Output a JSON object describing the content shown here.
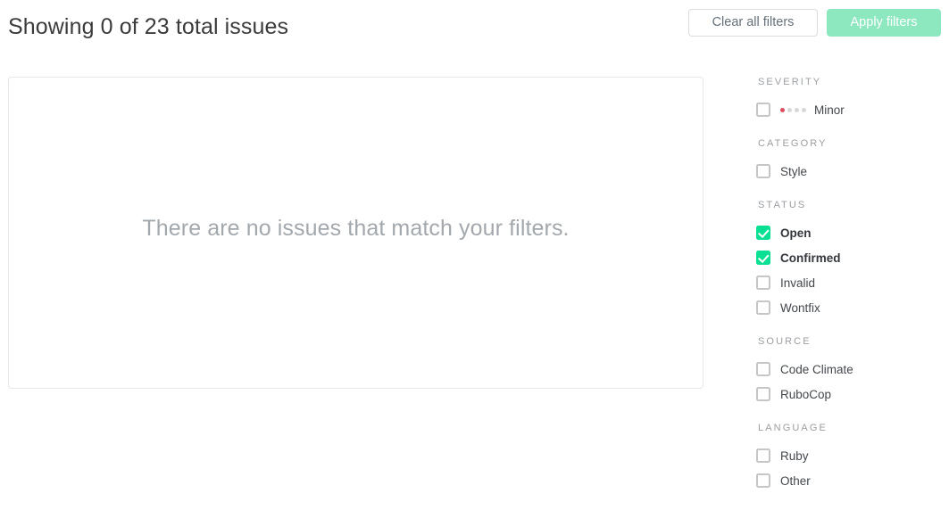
{
  "header": {
    "title": "Showing 0 of 23 total issues",
    "clear_label": "Clear all filters",
    "apply_label": "Apply filters"
  },
  "main": {
    "empty_message": "There are no issues that match your filters."
  },
  "colors": {
    "checkbox_checked": "#0ae094",
    "apply_button": "#8de8c0",
    "severity_dot_active": "#dd4b5e",
    "severity_dot_inactive": "#d8d8d8",
    "panel_border": "#e6e6e6"
  },
  "filters": [
    {
      "label": "SEVERITY",
      "items": [
        {
          "label": "Minor",
          "checked": false,
          "dots_total": 4,
          "dots_active": 1
        }
      ]
    },
    {
      "label": "CATEGORY",
      "items": [
        {
          "label": "Style",
          "checked": false
        }
      ]
    },
    {
      "label": "STATUS",
      "items": [
        {
          "label": "Open",
          "checked": true
        },
        {
          "label": "Confirmed",
          "checked": true
        },
        {
          "label": "Invalid",
          "checked": false
        },
        {
          "label": "Wontfix",
          "checked": false
        }
      ]
    },
    {
      "label": "SOURCE",
      "items": [
        {
          "label": "Code Climate",
          "checked": false
        },
        {
          "label": "RuboCop",
          "checked": false
        }
      ]
    },
    {
      "label": "LANGUAGE",
      "items": [
        {
          "label": "Ruby",
          "checked": false
        },
        {
          "label": "Other",
          "checked": false
        }
      ]
    }
  ]
}
